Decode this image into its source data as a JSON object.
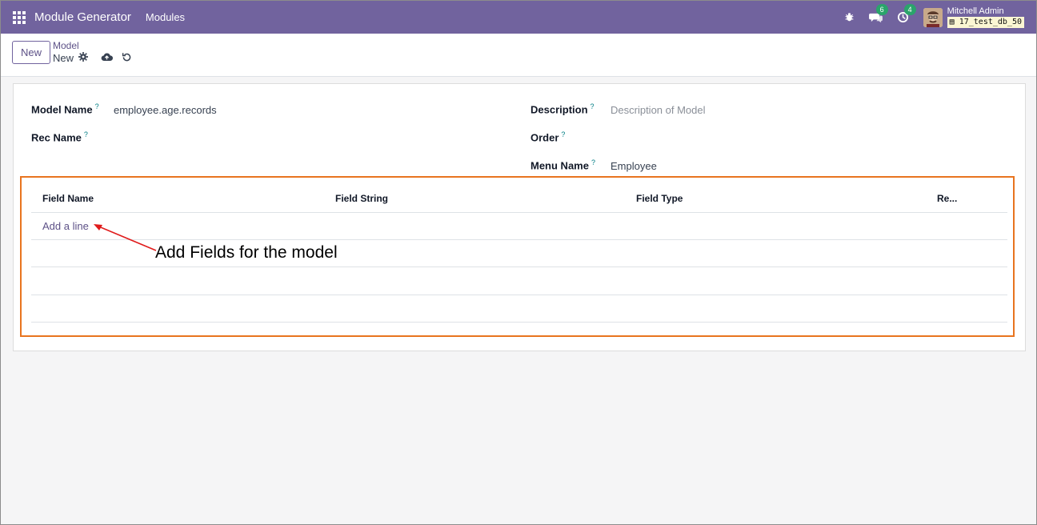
{
  "navbar": {
    "app_title": "Module Generator",
    "menu_item": "Modules",
    "messages_badge": "6",
    "activities_badge": "4",
    "user_name": "Mitchell Admin",
    "db_name": "17_test_db_50"
  },
  "control_panel": {
    "new_button": "New",
    "breadcrumb": "Model",
    "record_title": "New"
  },
  "form": {
    "model_name": {
      "label": "Model Name",
      "help": "?",
      "value": "employee.age.records"
    },
    "rec_name": {
      "label": "Rec Name",
      "help": "?"
    },
    "description": {
      "label": "Description",
      "help": "?",
      "placeholder": "Description of Model"
    },
    "order": {
      "label": "Order",
      "help": "?"
    },
    "menu_name": {
      "label": "Menu Name",
      "help": "?",
      "value": "Employee"
    }
  },
  "fields_table": {
    "columns": [
      "Field Name",
      "Field String",
      "Field Type",
      "Re..."
    ],
    "add_line": "Add a line"
  },
  "annotation": {
    "text": "Add Fields for the model",
    "color": "#e8741f"
  }
}
